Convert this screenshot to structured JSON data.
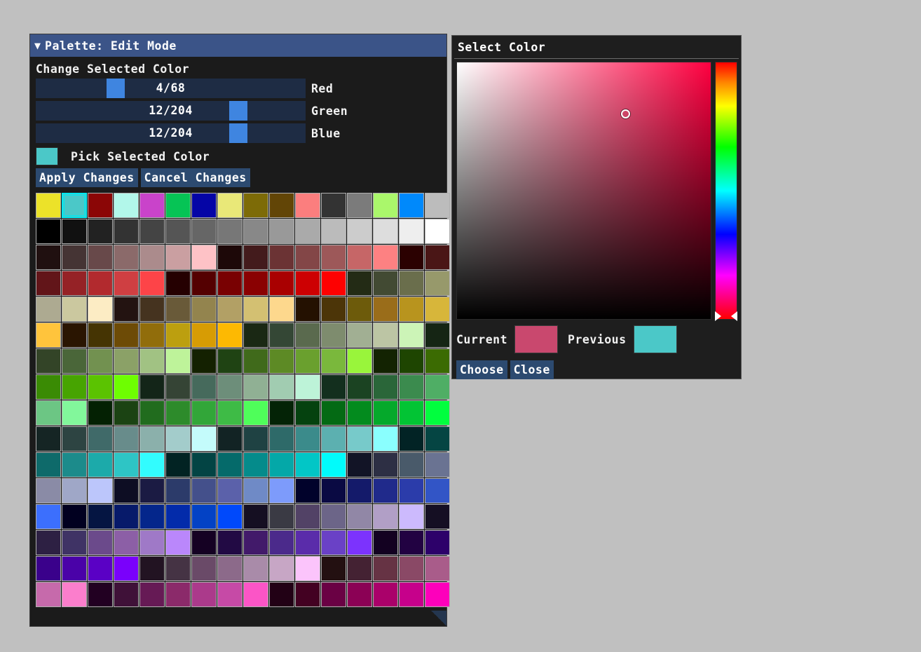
{
  "background_color": "#c0c0c0",
  "palette_window": {
    "title": "Palette: Edit Mode",
    "collapse_icon": "▼",
    "section_heading": "Change Selected Color",
    "sliders": [
      {
        "label": "Red",
        "value": "4/68",
        "percent": 28
      },
      {
        "label": "Green",
        "value": "12/204",
        "percent": 77
      },
      {
        "label": "Blue",
        "value": "12/204",
        "percent": 77
      }
    ],
    "pick_label": "Pick Selected Color",
    "pick_swatch_color": "#4bc8c8",
    "apply_label": "Apply Changes",
    "cancel_label": "Cancel Changes",
    "titlebar_color": "#3b5488",
    "slider_track_color": "#1e2c44",
    "slider_handle_color": "#3f85e0",
    "button_color": "#2c4a70",
    "selected_swatch_index": 1,
    "selection_border_color": "#00e8f0",
    "columns": 16,
    "swatches": [
      "#ece229",
      "#4bc8c8",
      "#8b0606",
      "#b2f7ea",
      "#c943ca",
      "#06c455",
      "#0505a6",
      "#e9e878",
      "#7d6b07",
      "#624506",
      "#fb7e7e",
      "#333333",
      "#7b7b7b",
      "#aaf76b",
      "#0089fb",
      "#bcbcbc",
      "#000000",
      "#111111",
      "#222222",
      "#333333",
      "#444444",
      "#555555",
      "#666666",
      "#777777",
      "#888888",
      "#999999",
      "#aaaaaa",
      "#bbbbbb",
      "#cccccc",
      "#dddddd",
      "#eeeeee",
      "#ffffff",
      "#201010",
      "#453434",
      "#68494a",
      "#8b6a6a",
      "#ab8b8c",
      "#ca9fa1",
      "#fec2c6",
      "#1d0808",
      "#431b1c",
      "#6b3334",
      "#834647",
      "#9d5859",
      "#c66667",
      "#fd8182",
      "#2b0101",
      "#4a1616",
      "#621519",
      "#952226",
      "#b22a2e",
      "#cf3f42",
      "#fd4448",
      "#250001",
      "#540001",
      "#790102",
      "#8a0102",
      "#a90001",
      "#cd0002",
      "#fe0101",
      "#232b15",
      "#424a33",
      "#6a6e4c",
      "#97996b",
      "#adaa91",
      "#cbc89f",
      "#fcecc4",
      "#231311",
      "#45331f",
      "#695a39",
      "#93844e",
      "#b2a065",
      "#d3c072",
      "#fdd88d",
      "#241101",
      "#4c3508",
      "#6d5b0b",
      "#9a6d1a",
      "#b8941e",
      "#d7b63a",
      "#ffc43c",
      "#2a1501",
      "#453403",
      "#6d4b06",
      "#916d0b",
      "#bc9f0f",
      "#d79c04",
      "#fdb902",
      "#1a2814",
      "#344735",
      "#5a6a4e",
      "#7e8c6e",
      "#a1af93",
      "#bcc5a4",
      "#ccf4b7",
      "#152514",
      "#334427",
      "#4a6639",
      "#729150",
      "#8ba167",
      "#a1c283",
      "#bef39a",
      "#142101",
      "#1f4313",
      "#406a1b",
      "#5d8a25",
      "#6aa02e",
      "#7ab83c",
      "#99f53b",
      "#132302",
      "#1e4501",
      "#3b6b02",
      "#3a8b04",
      "#47a401",
      "#5bc301",
      "#6efe01",
      "#132518",
      "#354435",
      "#466a5c",
      "#6d8e7a",
      "#90b094",
      "#a1ccb1",
      "#bdf3d8",
      "#132f1e",
      "#1b4322",
      "#2a6639",
      "#3b8b4e",
      "#4fae65",
      "#6cc684",
      "#82f79b",
      "#042103",
      "#1b4313",
      "#216c1e",
      "#2d8b2b",
      "#32a639",
      "#3ebb46",
      "#4ffe5a",
      "#042306",
      "#05420f",
      "#046a14",
      "#038b1e",
      "#05a92b",
      "#02c434",
      "#01fe3e",
      "#152524",
      "#2d4442",
      "#406a69",
      "#688c8b",
      "#8bb0ab",
      "#a3cccb",
      "#c4fbfb",
      "#122324",
      "#1f4243",
      "#2e6a69",
      "#3b8b8b",
      "#5cb0b0",
      "#77caca",
      "#8afffe",
      "#022325",
      "#054543",
      "#0e6a6a",
      "#1c8b8b",
      "#1caaaa",
      "#2ec5c5",
      "#32fcfe",
      "#022323",
      "#034444",
      "#056a6a",
      "#058b8b",
      "#04a8a8",
      "#02c6c6",
      "#01fbfb",
      "#121426",
      "#2d2f44",
      "#495a6a",
      "#6a7392",
      "#8a8ba6",
      "#9fa7c7",
      "#bcc6fb",
      "#0d0d23",
      "#1b1b43",
      "#2c3b6a",
      "#44508b",
      "#5b61aa",
      "#6f8ac6",
      "#7d9bfb",
      "#01022b",
      "#0a0a43",
      "#141a6a",
      "#202a8b",
      "#2b3caa",
      "#3255c6",
      "#3c6ffd",
      "#010020",
      "#051542",
      "#071a6a",
      "#04268b",
      "#032baa",
      "#0342c5",
      "#0049fb",
      "#150f22",
      "#3a3a44",
      "#524266",
      "#6c6588",
      "#9187a6",
      "#b19fc6",
      "#ccbafd",
      "#150f23",
      "#2d2043",
      "#3f3365",
      "#6b4a8b",
      "#8c5fa6",
      "#9f79c7",
      "#ba87fb",
      "#150123",
      "#220a44",
      "#421a6a",
      "#4b2a8b",
      "#5a2caa",
      "#6a41c6",
      "#7c33fd",
      "#130121",
      "#220242",
      "#2d016a",
      "#3a018b",
      "#4a02a8",
      "#5a01c5",
      "#7a01fb",
      "#221322",
      "#453344",
      "#6a4a68",
      "#8c6a8a",
      "#a98ba9",
      "#c7a6c5",
      "#fbc4fb",
      "#231011",
      "#442233",
      "#663344",
      "#8a4966",
      "#a95c8a",
      "#c66aab",
      "#fb7ecc",
      "#220022",
      "#3f1138",
      "#661a55",
      "#8b2a6a",
      "#ab3a8b",
      "#c64aa6",
      "#fb55c6",
      "#220115",
      "#430122",
      "#6a0144",
      "#8b0155",
      "#aa016a",
      "#c6018b",
      "#fd00bb"
    ]
  },
  "select_color_dialog": {
    "title": "Select Color",
    "sv_cursor": {
      "x_pct": 66.5,
      "y_pct": 20
    },
    "hue_marker_pct": 99,
    "current_label": "Current",
    "current_color": "#c9486e",
    "previous_label": "Previous",
    "previous_color": "#4bc8c8",
    "choose_label": "Choose",
    "close_label": "Close"
  }
}
